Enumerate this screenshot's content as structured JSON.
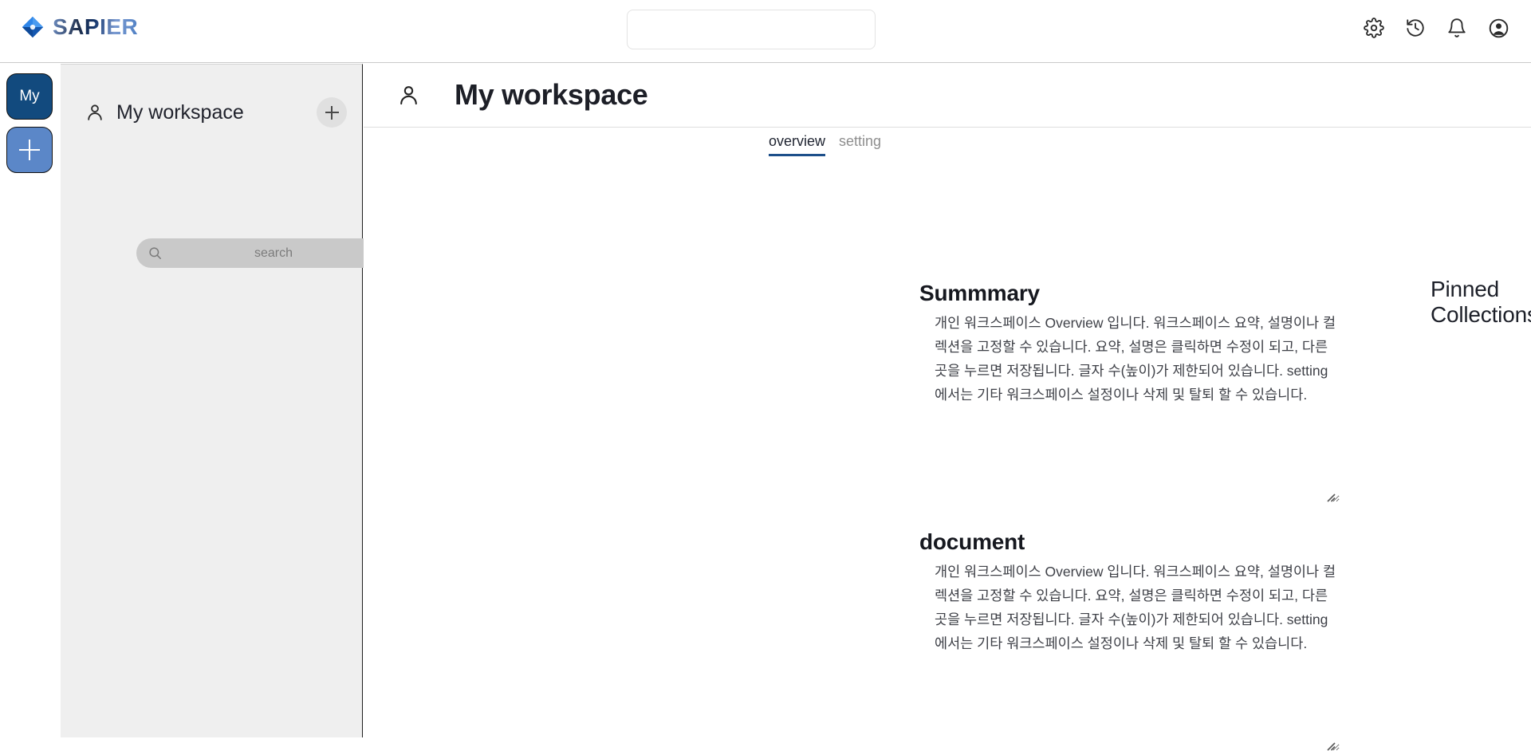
{
  "brand": {
    "name": "SAPIER",
    "logo_icon": "diamond-logo-icon",
    "logo_color": "#1a73d9"
  },
  "topbar": {
    "search": {
      "value": "",
      "placeholder": ""
    },
    "actions": [
      {
        "name": "settings",
        "icon": "gear-icon"
      },
      {
        "name": "history",
        "icon": "history-icon"
      },
      {
        "name": "notifications",
        "icon": "bell-icon"
      },
      {
        "name": "account",
        "icon": "account-circle-icon"
      }
    ]
  },
  "icon_rail": {
    "items": [
      {
        "label": "My",
        "name": "workspace-my",
        "color": "#124a7e"
      },
      {
        "label": "+",
        "name": "workspace-add",
        "color": "#5b87c8"
      }
    ]
  },
  "workspace_panel": {
    "person_icon": "person-icon",
    "title": "My workspace",
    "add_button_icon": "plus-icon",
    "search": {
      "value": "",
      "placeholder": "search"
    },
    "search_icon": "search-icon"
  },
  "main": {
    "person_icon": "person-icon",
    "page_title": "My workspace",
    "tabs": [
      {
        "label": "overview",
        "active": true
      },
      {
        "label": "setting",
        "active": false
      }
    ],
    "accent_color": "#1d4f8a",
    "sections": [
      {
        "title": "Summmary",
        "body": "개인 워크스페이스 Overview 입니다. 워크스페이스 요약, 설명이나 컬렉션을 고정할 수 있습니다. 요약, 설명은 클릭하면 수정이 되고, 다른곳을 누르면 저장됩니다. 글자 수(높이)가 제한되어 있습니다. setting에서는 기타 워크스페이스 설정이나 삭제 및 탈퇴 할 수 있습니다."
      },
      {
        "title": "document",
        "body": "개인 워크스페이스 Overview 입니다. 워크스페이스 요약, 설명이나 컬렉션을 고정할 수 있습니다. 요약, 설명은 클릭하면 수정이 되고, 다른곳을 누르면 저장됩니다. 글자 수(높이)가 제한되어 있습니다. setting에서는 기타 워크스페이스 설정이나 삭제 및 탈퇴 할 수 있습니다."
      }
    ],
    "pinned": {
      "title": "Pinned Collections",
      "add_icon": "plus-icon"
    }
  }
}
